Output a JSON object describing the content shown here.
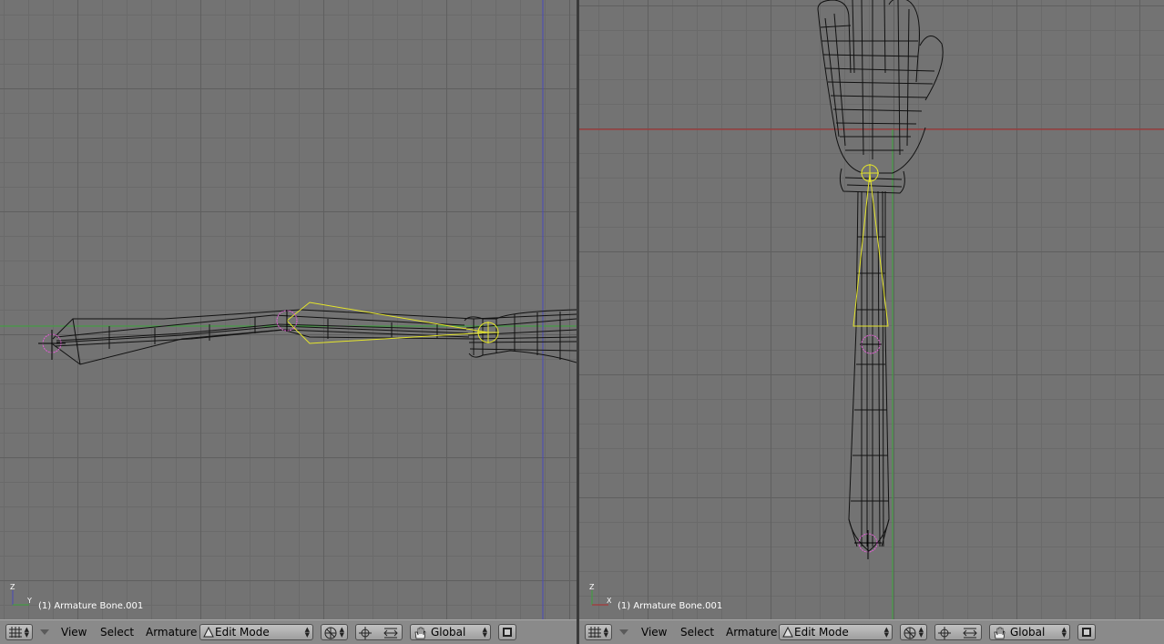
{
  "viewports": {
    "left": {
      "status_label": "(1) Armature Bone.001",
      "axis_labels": [
        "Z",
        "Y"
      ]
    },
    "right": {
      "status_label": "(1) Armature Bone.001",
      "axis_labels": [
        "Z",
        "X"
      ]
    }
  },
  "header": {
    "menus": [
      "View",
      "Select",
      "Armature"
    ],
    "mode_label": "Edit Mode",
    "orientation_label": "Global"
  },
  "icons": [
    "editor-grid-icon",
    "menu-collapse-arrow-icon",
    "edit-mode-icon",
    "draw-type-icon",
    "pivot-icon",
    "snap-icon",
    "hand-icon",
    "render-icon"
  ],
  "colors": {
    "viewport_bg": "#737373",
    "selected_bone": "#e5e52b",
    "bone_joint": "#e45cd7",
    "x_axis": "#b22a2a",
    "y_axis": "#3aa53a",
    "z_axis": "#4a4ab8"
  }
}
